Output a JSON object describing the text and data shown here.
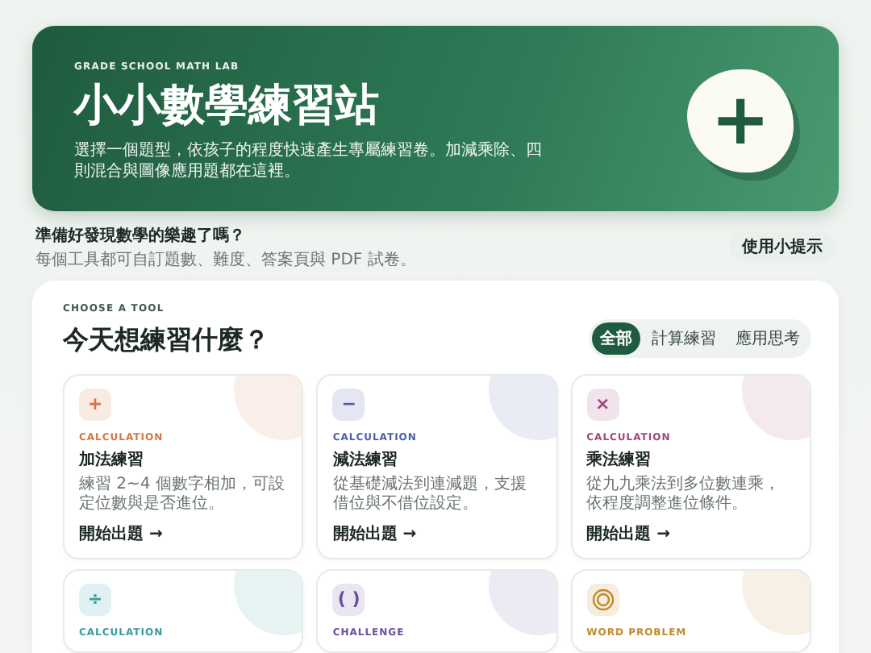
{
  "hero": {
    "eyebrow": "GRADE SCHOOL MATH LAB",
    "title": "小小數學練習站",
    "description": "選擇一個題型，依孩子的程度快速產生專屬練習卷。加減乘除、四則混合與圖像應用題都在這裡。",
    "badge": "+"
  },
  "intro": {
    "question": "準備好發現數學的樂趣了嗎？",
    "note": "每個工具都可自訂題數、難度、答案頁與 PDF 試卷。",
    "tips_button": "使用小提示"
  },
  "panel": {
    "eyebrow": "CHOOSE A TOOL",
    "heading": "今天想練習什麼？",
    "filters": [
      {
        "label": "全部",
        "selected": true
      },
      {
        "label": "計算練習",
        "selected": false
      },
      {
        "label": "應用思考",
        "selected": false
      }
    ],
    "cards": [
      {
        "kind": "glyph",
        "icon": "+",
        "color": "#d9743f",
        "category": "CALCULATION",
        "title": "加法練習",
        "description": "練習 2~4 個數字相加，可設定位數與是否進位。",
        "link": "開始出題 →"
      },
      {
        "kind": "glyph",
        "icon": "−",
        "color": "#4a5fa8",
        "category": "CALCULATION",
        "title": "減法練習",
        "description": "從基礎減法到連減題，支援借位與不借位設定。",
        "link": "開始出題 →"
      },
      {
        "kind": "glyph",
        "icon": "×",
        "color": "#a0477a",
        "category": "CALCULATION",
        "title": "乘法練習",
        "description": "從九九乘法到多位數連乘，依程度調整進位條件。",
        "link": "開始出題 →"
      },
      {
        "kind": "glyph",
        "icon": "÷",
        "color": "#3a9a9a",
        "category": "CALCULATION"
      },
      {
        "kind": "glyph",
        "icon": "( )",
        "color": "#6a4fa0",
        "category": "CHALLENGE"
      },
      {
        "kind": "rings",
        "color": "#c08a2a",
        "category": "WORD PROBLEM"
      }
    ]
  }
}
